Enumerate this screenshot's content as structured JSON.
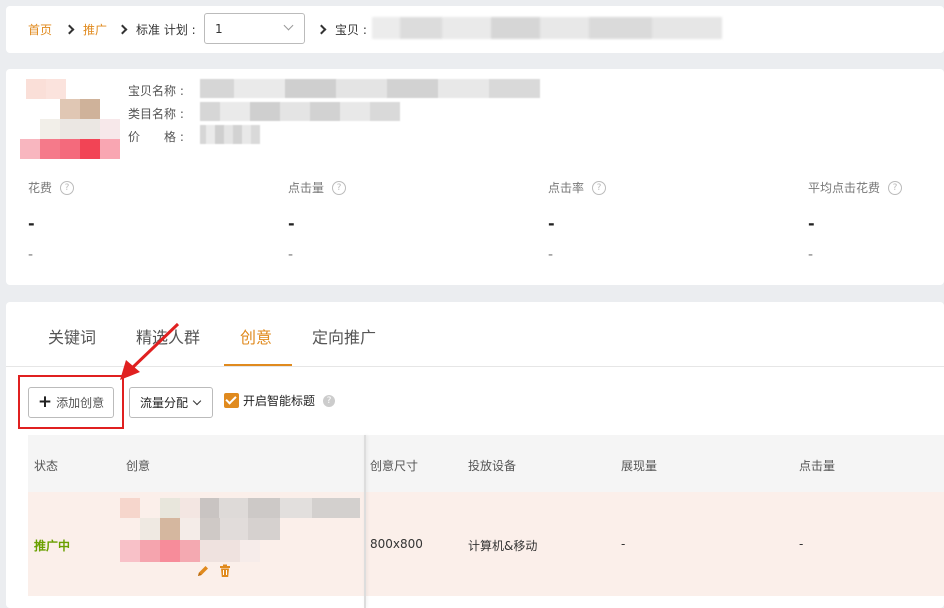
{
  "breadcrumb": {
    "home": "首页",
    "promote": "推广",
    "plan_label": "标准 计划 :",
    "plan_value": "1",
    "item_label": "宝贝 :"
  },
  "product": {
    "name_label": "宝贝名称 :",
    "category_label": "类目名称 :",
    "price_label": "价　　格 :"
  },
  "metrics": [
    {
      "label": "花费",
      "value": "-",
      "sub": "-"
    },
    {
      "label": "点击量",
      "value": "-",
      "sub": "-"
    },
    {
      "label": "点击率",
      "value": "-",
      "sub": "-"
    },
    {
      "label": "平均点击花费",
      "value": "-",
      "sub": "-"
    }
  ],
  "help_icon_glyph": "?",
  "tabs": [
    "关键词",
    "精选人群",
    "创意",
    "定向推广"
  ],
  "active_tab": "创意",
  "toolbar": {
    "add_plus": "+",
    "add_label": "添加创意",
    "flow_label": "流量分配",
    "smart_title_label": "开启智能标题"
  },
  "table": {
    "headers": [
      "状态",
      "创意",
      "创意尺寸",
      "投放设备",
      "展现量",
      "点击量"
    ],
    "rows": [
      {
        "status": "推广中",
        "size": "800x800",
        "device": "计算机&移动",
        "impressions": "-",
        "clicks": "-"
      }
    ]
  },
  "colors": {
    "accent": "#e08a1e",
    "status_green": "#6aa000",
    "annotation_red": "#e02020"
  },
  "icons": {
    "edit": "pencil-icon",
    "delete": "trash-icon",
    "help": "question-circle-icon"
  }
}
